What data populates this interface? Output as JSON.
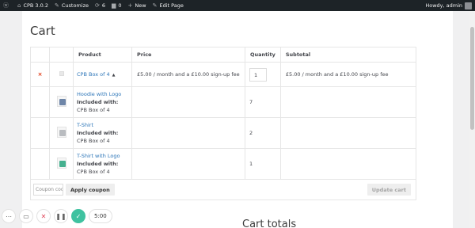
{
  "adminbar": {
    "site": "CPB 3.0.2",
    "customize": "Customize",
    "updates_count": "6",
    "comments_count": "0",
    "new_label": "New",
    "edit_page": "Edit Page",
    "greeting": "Howdy, admin"
  },
  "page": {
    "title": "Cart",
    "totals_title": "Cart totals"
  },
  "table": {
    "headers": {
      "product": "Product",
      "price": "Price",
      "quantity": "Quantity",
      "subtotal": "Subtotal"
    },
    "main_row": {
      "remove": "×",
      "product": "CPB Box of 4",
      "caret": "▲",
      "price": "£5.00 / month and a £10.00 sign-up fee",
      "quantity": "1",
      "subtotal": "£5.00 / month and a £10.00 sign-up fee"
    },
    "children": [
      {
        "product": "Hoodie with Logo",
        "included_label": "Included with:",
        "included_in": "CPB Box of 4",
        "quantity": "7",
        "icon": "hoodie-icon",
        "color": "#6e86a8"
      },
      {
        "product": "T-Shirt",
        "included_label": "Included with:",
        "included_in": "CPB Box of 4",
        "quantity": "2",
        "icon": "tshirt-icon",
        "color": "#b9bcc0"
      },
      {
        "product": "T-Shirt with Logo",
        "included_label": "Included with:",
        "included_in": "CPB Box of 4",
        "quantity": "1",
        "icon": "tshirt-logo-icon",
        "color": "#45b08f"
      }
    ],
    "coupon": {
      "placeholder": "Coupon code",
      "apply_label": "Apply coupon",
      "update_label": "Update cart"
    }
  },
  "recorder": {
    "time": "5:00"
  }
}
